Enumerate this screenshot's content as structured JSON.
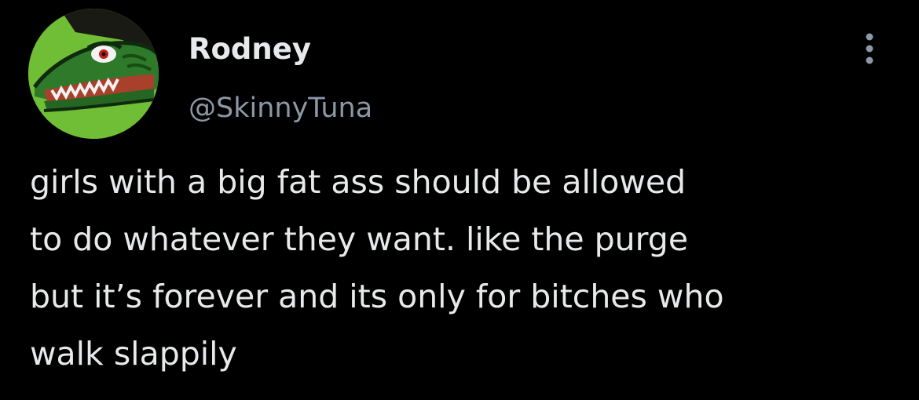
{
  "author": {
    "display_name": "Rodney",
    "handle": "@SkinnyTuna",
    "avatar_icon": "lizard-avatar-icon"
  },
  "more_icon": "more-dots-icon",
  "tweet": {
    "lines": [
      "girls with a big fat ass should be allowed",
      "to do whatever they want. like the purge",
      "but it’s forever and its only for bitches who",
      "walk slappily"
    ]
  },
  "colors": {
    "background": "#000000",
    "primary_text": "#e7e9ea",
    "secondary_text": "#8b98a5",
    "avatar_bg": "#6fbe35"
  }
}
